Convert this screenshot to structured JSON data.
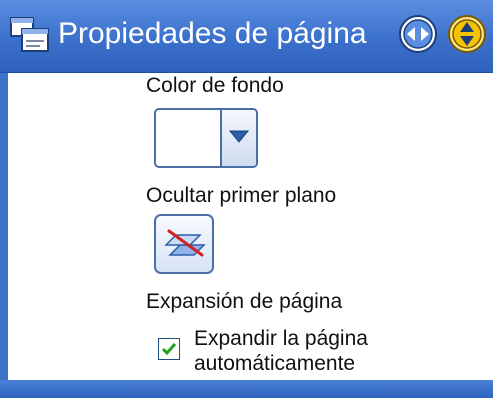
{
  "panel": {
    "title": "Propiedades de página",
    "icons": {
      "title": "page-properties-icon",
      "nav_left_right": "left-right-arrows-icon",
      "nav_up_down": "up-down-arrows-icon"
    }
  },
  "background": {
    "label": "Color de fondo",
    "selected_color": "#ffffff"
  },
  "foreground": {
    "label": "Ocultar primer plano"
  },
  "expansion": {
    "label": "Expansión de página",
    "checkbox_label_line1": "Expandir la página",
    "checkbox_label_line2": "automáticamente",
    "checked": true
  },
  "colors": {
    "titlebar": "#3b70cc",
    "border": "#3d72c9",
    "accent_yellow": "#f5c400",
    "check_green": "#21a121"
  }
}
